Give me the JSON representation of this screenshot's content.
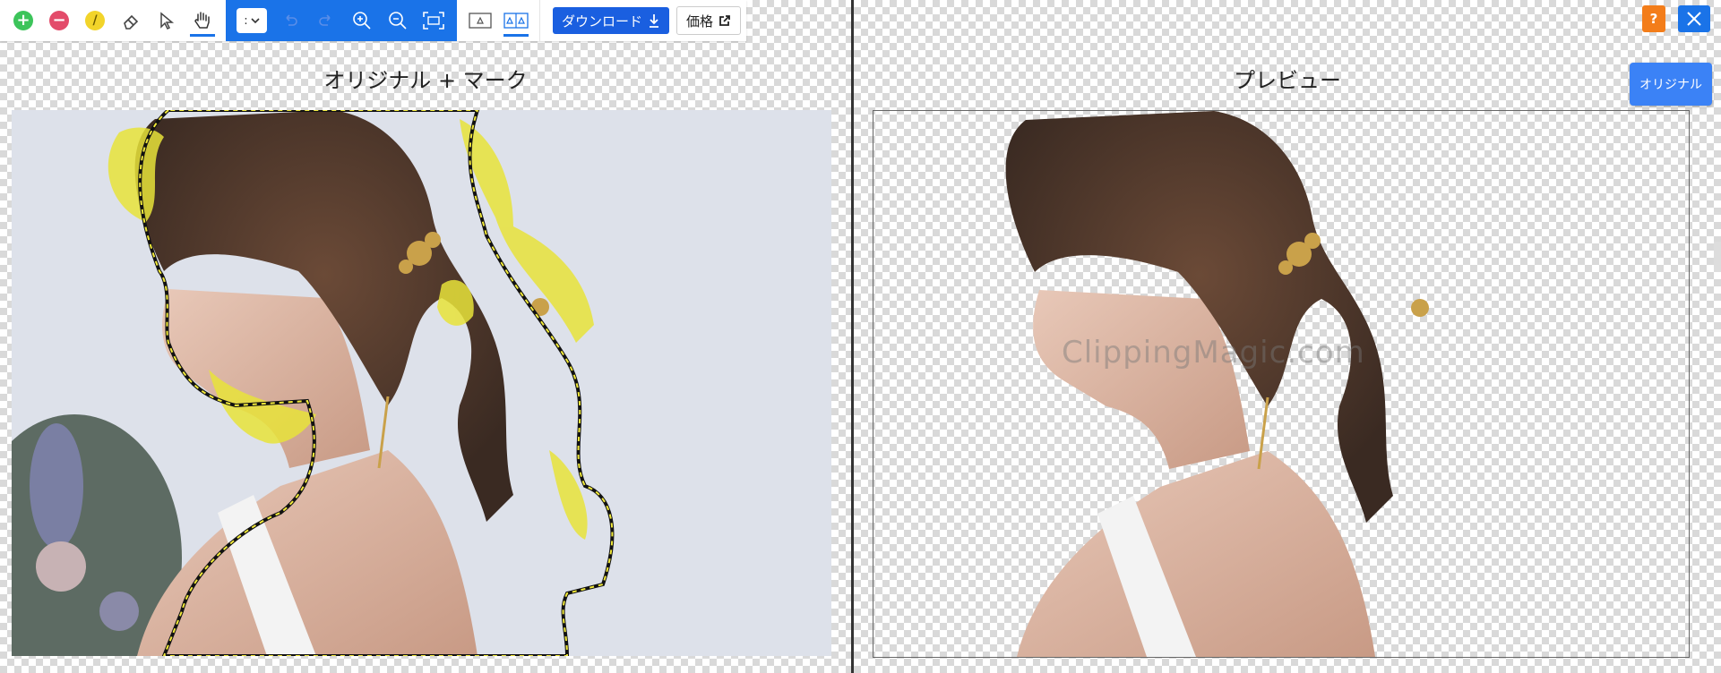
{
  "toolbar": {
    "tools": [
      {
        "name": "keep-brush",
        "icon": "plus-circle-icon",
        "color": "#3cc45a"
      },
      {
        "name": "remove-brush",
        "icon": "minus-circle-icon",
        "color": "#e34b6a"
      },
      {
        "name": "hair-brush",
        "icon": "slash-circle-icon",
        "color": "#f2d42a"
      },
      {
        "name": "eraser",
        "icon": "eraser-icon"
      },
      {
        "name": "select",
        "icon": "arrow-cursor-icon"
      },
      {
        "name": "pan",
        "icon": "hand-icon",
        "active": true
      }
    ],
    "brush_size_value": ":",
    "undo_icon": "undo-icon",
    "redo_icon": "redo-icon",
    "zoom_in_icon": "zoom-in-icon",
    "zoom_out_icon": "zoom-out-icon",
    "fit_icon": "fit-screen-icon",
    "view_single_icon": "single-view-icon",
    "view_split_icon": "split-view-icon",
    "download_label": "ダウンロード",
    "price_label": "価格"
  },
  "left_pane": {
    "title": "オリジナル + マーク"
  },
  "right_pane": {
    "title": "プレビュー",
    "watermark": "ClippingMagic.com",
    "help_label": "?",
    "original_label": "オリジナル"
  },
  "colors": {
    "accent": "#1a73e8",
    "download": "#1a5fe0",
    "help": "#f37d1a",
    "hair_mark": "#e8e33a"
  }
}
